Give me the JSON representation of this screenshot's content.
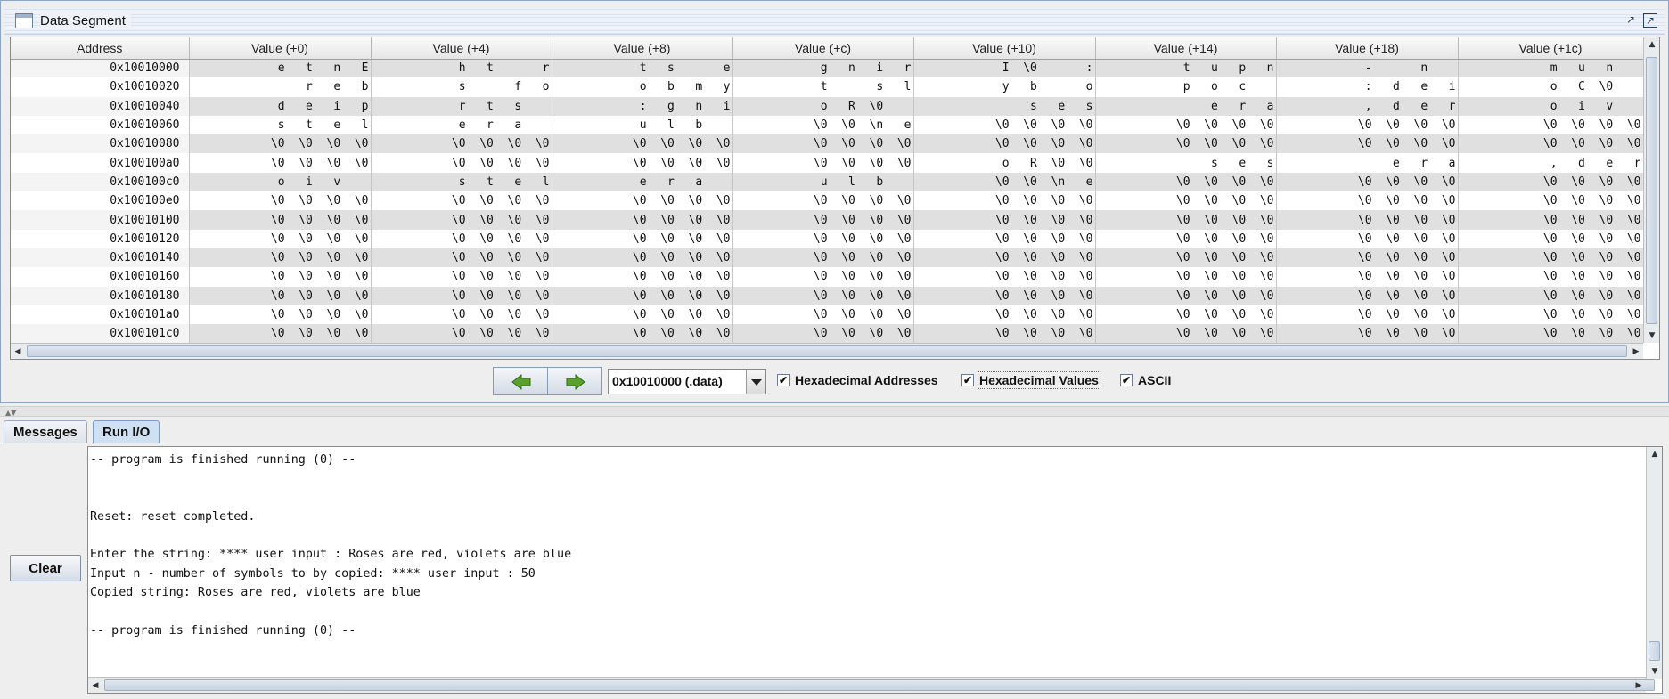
{
  "window": {
    "title": "Data Segment"
  },
  "table": {
    "headers": [
      "Address",
      "Value (+0)",
      "Value (+4)",
      "Value (+8)",
      "Value (+c)",
      "Value (+10)",
      "Value (+14)",
      "Value (+18)",
      "Value (+1c)"
    ],
    "rows": [
      [
        "0x10010000",
        "  e   t   n   E",
        "  h   t       r",
        "  t   s       e",
        "  g   n   i   r",
        "  I  \\0       :",
        "  t   u   p   n",
        "  -       n    ",
        "  m   u   n    "
      ],
      [
        "0x10010020",
        "          r   e   b",
        "  s       f   o",
        "  o   b   m   y",
        "  t       s   l",
        "  y   b       o",
        "  p   o   c    ",
        "  :   d   e   i",
        "  o   C  \\0    "
      ],
      [
        "0x10010040",
        "  d   e   i   p",
        "  r   t   s    ",
        "  :   g   n   i",
        "  o   R  \\0    ",
        "      s   e   s",
        "      e   r   a",
        "  ,   d   e   r",
        "  o   i   v    "
      ],
      [
        "0x10010060",
        "  s   t   e   l",
        "  e   r   a    ",
        "  u   l   b    ",
        "\\0  \\0  \\n   e",
        "\\0  \\0  \\0  \\0",
        "\\0  \\0  \\0  \\0",
        "\\0  \\0  \\0  \\0",
        "\\0  \\0  \\0  \\0"
      ],
      [
        "0x10010080",
        "\\0  \\0  \\0  \\0",
        "\\0  \\0  \\0  \\0",
        "\\0  \\0  \\0  \\0",
        "\\0  \\0  \\0  \\0",
        "\\0  \\0  \\0  \\0",
        "\\0  \\0  \\0  \\0",
        "\\0  \\0  \\0  \\0",
        "\\0  \\0  \\0  \\0"
      ],
      [
        "0x100100a0",
        "\\0  \\0  \\0  \\0",
        "\\0  \\0  \\0  \\0",
        "\\0  \\0  \\0  \\0",
        "\\0  \\0  \\0  \\0",
        "  o   R  \\0  \\0",
        "      s   e   s",
        "      e   r   a",
        "  ,   d   e   r"
      ],
      [
        "0x100100c0",
        "  o   i   v    ",
        "  s   t   e   l",
        "  e   r   a    ",
        "  u   l   b    ",
        "\\0  \\0  \\n   e",
        "\\0  \\0  \\0  \\0",
        "\\0  \\0  \\0  \\0",
        "\\0  \\0  \\0  \\0"
      ],
      [
        "0x100100e0",
        "\\0  \\0  \\0  \\0",
        "\\0  \\0  \\0  \\0",
        "\\0  \\0  \\0  \\0",
        "\\0  \\0  \\0  \\0",
        "\\0  \\0  \\0  \\0",
        "\\0  \\0  \\0  \\0",
        "\\0  \\0  \\0  \\0",
        "\\0  \\0  \\0  \\0"
      ],
      [
        "0x10010100",
        "\\0  \\0  \\0  \\0",
        "\\0  \\0  \\0  \\0",
        "\\0  \\0  \\0  \\0",
        "\\0  \\0  \\0  \\0",
        "\\0  \\0  \\0  \\0",
        "\\0  \\0  \\0  \\0",
        "\\0  \\0  \\0  \\0",
        "\\0  \\0  \\0  \\0"
      ],
      [
        "0x10010120",
        "\\0  \\0  \\0  \\0",
        "\\0  \\0  \\0  \\0",
        "\\0  \\0  \\0  \\0",
        "\\0  \\0  \\0  \\0",
        "\\0  \\0  \\0  \\0",
        "\\0  \\0  \\0  \\0",
        "\\0  \\0  \\0  \\0",
        "\\0  \\0  \\0  \\0"
      ],
      [
        "0x10010140",
        "\\0  \\0  \\0  \\0",
        "\\0  \\0  \\0  \\0",
        "\\0  \\0  \\0  \\0",
        "\\0  \\0  \\0  \\0",
        "\\0  \\0  \\0  \\0",
        "\\0  \\0  \\0  \\0",
        "\\0  \\0  \\0  \\0",
        "\\0  \\0  \\0  \\0"
      ],
      [
        "0x10010160",
        "\\0  \\0  \\0  \\0",
        "\\0  \\0  \\0  \\0",
        "\\0  \\0  \\0  \\0",
        "\\0  \\0  \\0  \\0",
        "\\0  \\0  \\0  \\0",
        "\\0  \\0  \\0  \\0",
        "\\0  \\0  \\0  \\0",
        "\\0  \\0  \\0  \\0"
      ],
      [
        "0x10010180",
        "\\0  \\0  \\0  \\0",
        "\\0  \\0  \\0  \\0",
        "\\0  \\0  \\0  \\0",
        "\\0  \\0  \\0  \\0",
        "\\0  \\0  \\0  \\0",
        "\\0  \\0  \\0  \\0",
        "\\0  \\0  \\0  \\0",
        "\\0  \\0  \\0  \\0"
      ],
      [
        "0x100101a0",
        "\\0  \\0  \\0  \\0",
        "\\0  \\0  \\0  \\0",
        "\\0  \\0  \\0  \\0",
        "\\0  \\0  \\0  \\0",
        "\\0  \\0  \\0  \\0",
        "\\0  \\0  \\0  \\0",
        "\\0  \\0  \\0  \\0",
        "\\0  \\0  \\0  \\0"
      ],
      [
        "0x100101c0",
        "\\0  \\0  \\0  \\0",
        "\\0  \\0  \\0  \\0",
        "\\0  \\0  \\0  \\0",
        "\\0  \\0  \\0  \\0",
        "\\0  \\0  \\0  \\0",
        "\\0  \\0  \\0  \\0",
        "\\0  \\0  \\0  \\0",
        "\\0  \\0  \\0  \\0"
      ]
    ]
  },
  "controls": {
    "prev_icon": "arrow-left-icon",
    "next_icon": "arrow-right-icon",
    "address_select": "0x10010000 (.data)",
    "hex_addresses_label": "Hexadecimal Addresses",
    "hex_addresses_checked": true,
    "hex_values_label": "Hexadecimal Values",
    "hex_values_checked": true,
    "ascii_label": "ASCII",
    "ascii_checked": true,
    "arrow_color": "#5aa02c"
  },
  "tabs": [
    {
      "label": "Messages",
      "active": false
    },
    {
      "label": "Run I/O",
      "active": true
    }
  ],
  "io": {
    "clear_label": "Clear",
    "lines": [
      "-- program is finished running (0) --",
      "",
      "",
      "Reset: reset completed.",
      "",
      "Enter the string: **** user input : Roses are red, violets are blue",
      "Input n - number of symbols to by copied: **** user input : 50",
      "Copied string: Roses are red, violets are blue",
      "",
      "-- program is finished running (0) --"
    ]
  }
}
